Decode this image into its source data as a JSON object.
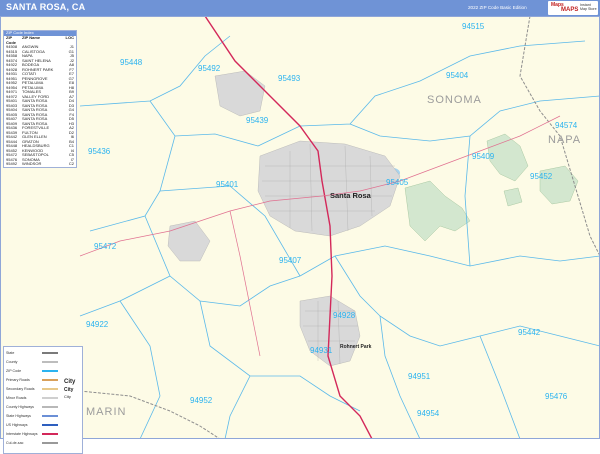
{
  "header": {
    "title": "SANTA ROSA, CA",
    "edition": "2022 ZIP Code Basic Edition",
    "logo_line1": "Maps",
    "logo_line2": "MAPS",
    "logo_line3": "Instant Map Store"
  },
  "zip_index": {
    "title": "ZIP Code Index",
    "headers": [
      "ZIP Code",
      "ZIP Name",
      "LOC"
    ],
    "rows": [
      [
        "94508",
        "ANGWIN",
        "J1"
      ],
      [
        "94515",
        "CALISTOGA",
        "G1"
      ],
      [
        "94558",
        "NAPA",
        "J5"
      ],
      [
        "94574",
        "SAINT HELENA",
        "J2"
      ],
      [
        "94922",
        "BODEGA",
        "A8"
      ],
      [
        "94928",
        "ROHNERT PARK",
        "F7"
      ],
      [
        "94931",
        "COTATI",
        "E7"
      ],
      [
        "94951",
        "PENNGROVE",
        "G7"
      ],
      [
        "94952",
        "PETALUMA",
        "E8"
      ],
      [
        "94954",
        "PETALUMA",
        "H8"
      ],
      [
        "94971",
        "TOMALES",
        "B9"
      ],
      [
        "94972",
        "VALLEY FORD",
        "A7"
      ],
      [
        "95401",
        "SANTA ROSA",
        "D4"
      ],
      [
        "95403",
        "SANTA ROSA",
        "D3"
      ],
      [
        "95404",
        "SANTA ROSA",
        "G4"
      ],
      [
        "95405",
        "SANTA ROSA",
        "F4"
      ],
      [
        "95407",
        "SANTA ROSA",
        "D5"
      ],
      [
        "95409",
        "SANTA ROSA",
        "H3"
      ],
      [
        "95436",
        "FORESTVILLE",
        "A2"
      ],
      [
        "95439",
        "FULTON",
        "D2"
      ],
      [
        "95442",
        "GLEN ELLEN",
        "I6"
      ],
      [
        "95444",
        "GRATON",
        "B4"
      ],
      [
        "95448",
        "HEALDSBURG",
        "C1"
      ],
      [
        "95452",
        "KENWOOD",
        "I4"
      ],
      [
        "95472",
        "SEBASTOPOL",
        "C5"
      ],
      [
        "95476",
        "SONOMA",
        "I7"
      ],
      [
        "95492",
        "WINDSOR",
        "C2"
      ]
    ]
  },
  "legend": {
    "rows": [
      {
        "label": "State",
        "color": "#7a7a7a"
      },
      {
        "label": "County",
        "color": "#bdbdbd"
      },
      {
        "label": "ZIP Code",
        "color": "#2bb3f0"
      },
      {
        "label": "Primary Roads",
        "color": "#d9a05a"
      },
      {
        "label": "Secondary Roads",
        "color": "#e8c98a"
      },
      {
        "label": "Minor Roads",
        "color": "#cfcfcf"
      },
      {
        "label": "County Highways",
        "color": "#b8b8b8"
      },
      {
        "label": "State Highways",
        "color": "#6b8fd6"
      },
      {
        "label": "US Highways",
        "color": "#2e5fbf"
      },
      {
        "label": "Interstate Highways",
        "color": "#d3285a"
      },
      {
        "label": "Cul-de-sac",
        "color": "#999999"
      }
    ],
    "city_big": "City",
    "city_mid": "City",
    "city_small": "City"
  },
  "map": {
    "counties": [
      "SONOMA",
      "NAPA",
      "MARIN"
    ],
    "cities": [
      "Santa Rosa",
      "Rohnert Park"
    ],
    "zip_codes": [
      "94515",
      "95448",
      "95492",
      "95493",
      "95404",
      "94574",
      "95439",
      "95436",
      "95409",
      "95401",
      "95405",
      "95452",
      "95472",
      "95407",
      "94922",
      "94928",
      "95442",
      "94931",
      "94951",
      "94952",
      "95476",
      "94954"
    ],
    "colors": {
      "land": "#fdfbe6",
      "park": "#d3e7cf",
      "zip_boundary": "#2bb3f0",
      "interstate": "#d3285a",
      "urban": "#b9b9b9"
    }
  }
}
